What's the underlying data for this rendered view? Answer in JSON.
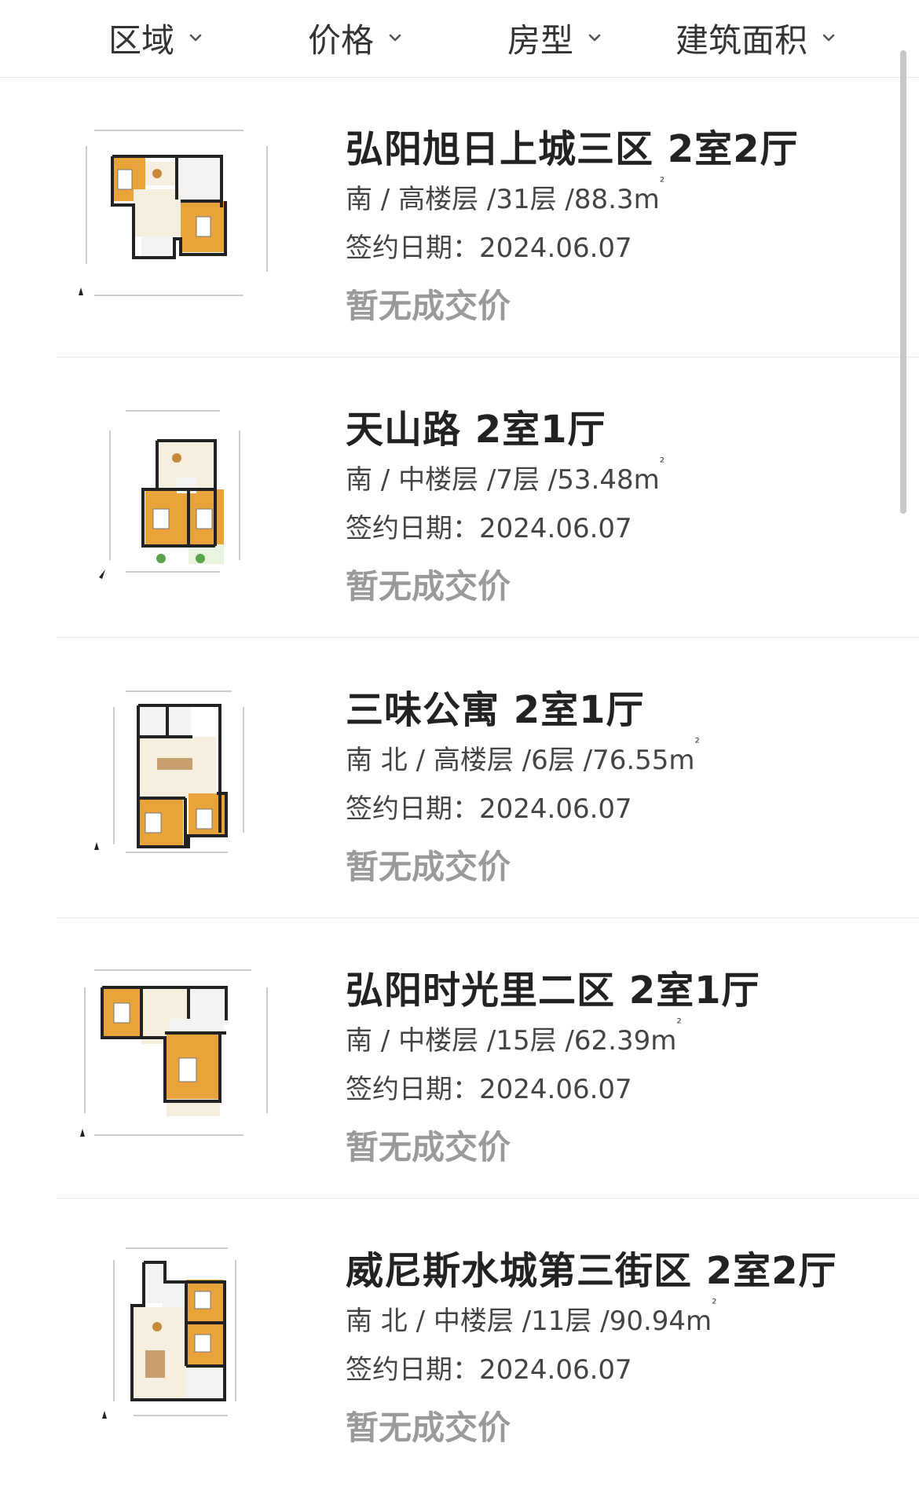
{
  "filters": [
    {
      "label": "区域",
      "icon": "chevron-down-icon"
    },
    {
      "label": "价格",
      "icon": "chevron-down-icon"
    },
    {
      "label": "房型",
      "icon": "chevron-down-icon"
    },
    {
      "label": "建筑面积",
      "icon": "chevron-down-icon"
    }
  ],
  "listings": [
    {
      "title": "弘阳旭日上城三区 2室2厅",
      "orientation": "南",
      "floor": "高楼层",
      "total_floors": "31层",
      "area": "88.3m",
      "area_sup": "²",
      "date_label": "签约日期：",
      "date": "2024.06.07",
      "price": "暂无成交价"
    },
    {
      "title": "天山路 2室1厅",
      "orientation": "南",
      "floor": "中楼层",
      "total_floors": "7层",
      "area": "53.48m",
      "area_sup": "²",
      "date_label": "签约日期：",
      "date": "2024.06.07",
      "price": "暂无成交价"
    },
    {
      "title": "三味公寓 2室1厅",
      "orientation": "南 北",
      "floor": "高楼层",
      "total_floors": "6层",
      "area": "76.55m",
      "area_sup": "²",
      "date_label": "签约日期：",
      "date": "2024.06.07",
      "price": "暂无成交价"
    },
    {
      "title": "弘阳时光里二区 2室1厅",
      "orientation": "南",
      "floor": "中楼层",
      "total_floors": "15层",
      "area": "62.39m",
      "area_sup": "²",
      "date_label": "签约日期：",
      "date": "2024.06.07",
      "price": "暂无成交价"
    },
    {
      "title": "威尼斯水城第三街区 2室2厅",
      "orientation": "南 北",
      "floor": "中楼层",
      "total_floors": "11层",
      "area": "90.94m",
      "area_sup": "²",
      "date_label": "签约日期：",
      "date": "2024.06.07",
      "price": "暂无成交价"
    }
  ],
  "colors": {
    "room": "#e8a33a",
    "wall": "#222222",
    "price_gray": "#9a9a9a"
  }
}
